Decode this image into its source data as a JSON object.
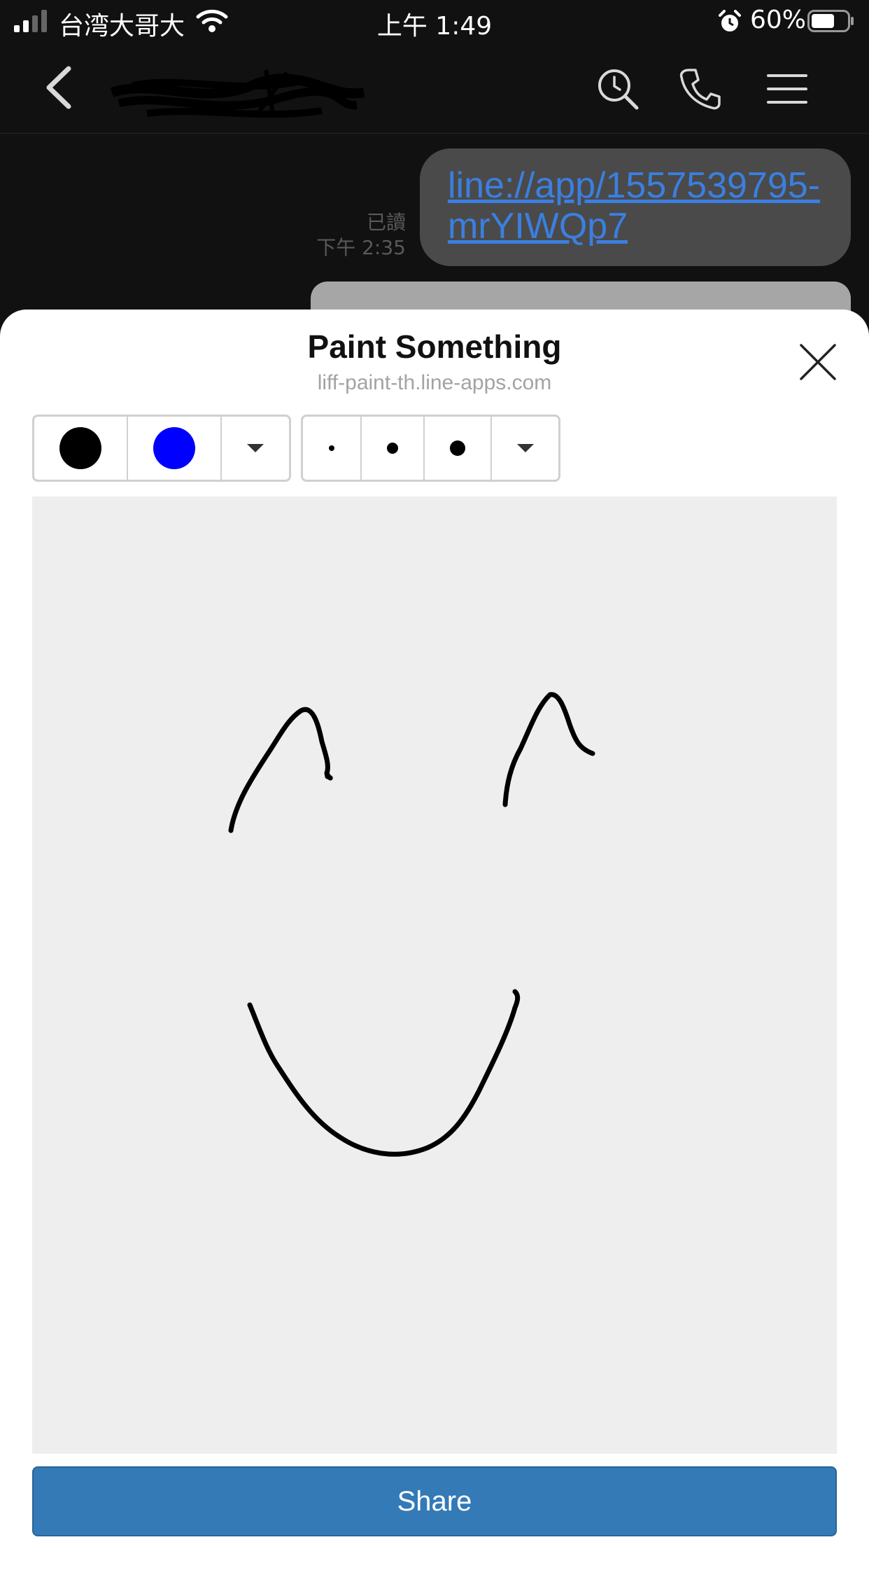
{
  "status_bar": {
    "carrier": "台湾大哥大",
    "time": "上午 1:49",
    "battery_percent": "60%",
    "icons": [
      "signal-icon",
      "wifi-icon",
      "alarm-icon",
      "battery-icon"
    ]
  },
  "chat_header": {
    "icons": [
      "back-icon",
      "search-icon",
      "call-icon",
      "menu-icon"
    ]
  },
  "messages": [
    {
      "read_label": "已讀",
      "time": "下午 2:35",
      "text": "line://app/1557539795-mrYIWQp7"
    }
  ],
  "sheet": {
    "title": "Paint Something",
    "subtitle": "liff-paint-th.line-apps.com",
    "colors": [
      "#000000",
      "#0000ff"
    ],
    "brush_sizes": [
      "small",
      "medium",
      "large"
    ],
    "share_label": "Share",
    "icons": [
      "close-icon",
      "chevron-down-icon"
    ]
  },
  "colors": {
    "share_button": "#337ab7",
    "link": "#3b7fe0",
    "canvas_bg": "#eeeeee"
  }
}
